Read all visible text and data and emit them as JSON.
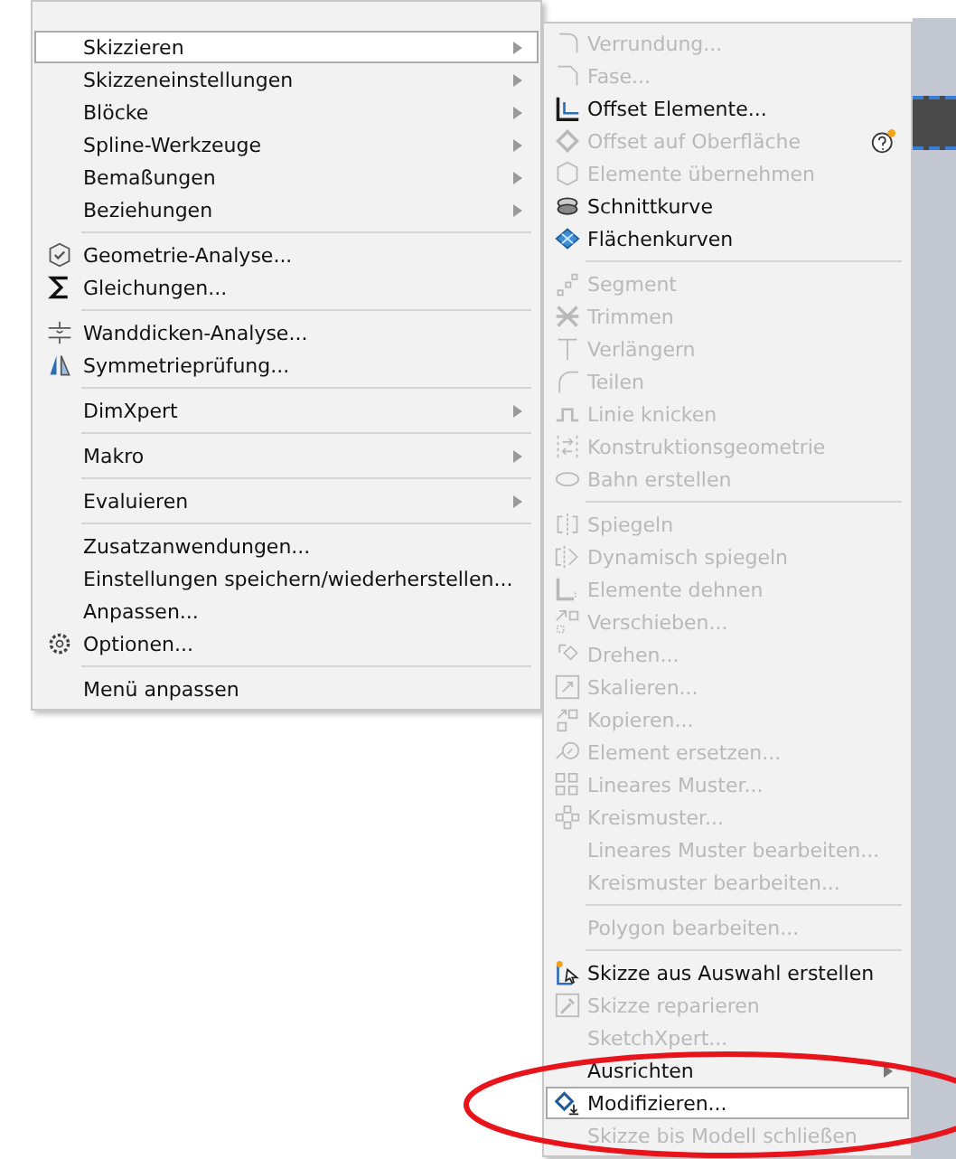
{
  "main_menu": {
    "items": [
      {
        "kind": "item",
        "label": "Skizzieren",
        "has_submenu": true,
        "selected": true
      },
      {
        "kind": "item",
        "label": "Skizzeneinstellungen",
        "has_submenu": true,
        "selected": false
      },
      {
        "kind": "item",
        "label": "Blöcke",
        "has_submenu": true,
        "selected": false
      },
      {
        "kind": "item",
        "label": "Spline-Werkzeuge",
        "has_submenu": true,
        "selected": false
      },
      {
        "kind": "item",
        "label": "Bemaßungen",
        "has_submenu": true,
        "selected": false
      },
      {
        "kind": "item",
        "label": "Beziehungen",
        "has_submenu": true,
        "selected": false
      },
      {
        "kind": "separator"
      },
      {
        "kind": "item",
        "label": "Geometrie-Analyse...",
        "has_submenu": false,
        "selected": false
      },
      {
        "kind": "item",
        "label": "Gleichungen...",
        "has_submenu": false,
        "selected": false
      },
      {
        "kind": "separator"
      },
      {
        "kind": "item",
        "label": "Wanddicken-Analyse...",
        "has_submenu": false,
        "selected": false
      },
      {
        "kind": "item",
        "label": "Symmetrieprüfung...",
        "has_submenu": false,
        "selected": false
      },
      {
        "kind": "separator"
      },
      {
        "kind": "item",
        "label": "DimXpert",
        "has_submenu": true,
        "selected": false
      },
      {
        "kind": "separator"
      },
      {
        "kind": "item",
        "label": "Makro",
        "has_submenu": true,
        "selected": false
      },
      {
        "kind": "separator"
      },
      {
        "kind": "item",
        "label": "Evaluieren",
        "has_submenu": true,
        "selected": false
      },
      {
        "kind": "separator"
      },
      {
        "kind": "item",
        "label": "Zusatzanwendungen...",
        "has_submenu": false,
        "selected": false
      },
      {
        "kind": "item",
        "label": "Einstellungen speichern/wiederherstellen...",
        "has_submenu": false,
        "selected": false
      },
      {
        "kind": "item",
        "label": "Anpassen...",
        "has_submenu": false,
        "selected": false
      },
      {
        "kind": "item",
        "label": "Optionen...",
        "has_submenu": false,
        "selected": false
      },
      {
        "kind": "separator"
      },
      {
        "kind": "item",
        "label": "Menü anpassen",
        "has_submenu": false,
        "selected": false
      }
    ]
  },
  "submenu": {
    "items": [
      {
        "kind": "item",
        "label": "Verrundung...",
        "disabled": true,
        "has_submenu": false,
        "selected": false
      },
      {
        "kind": "item",
        "label": "Fase...",
        "disabled": true,
        "has_submenu": false,
        "selected": false
      },
      {
        "kind": "item",
        "label": "Offset Elemente...",
        "disabled": false,
        "has_submenu": false,
        "selected": false
      },
      {
        "kind": "item",
        "label": "Offset auf Oberfläche",
        "disabled": true,
        "has_submenu": false,
        "selected": false
      },
      {
        "kind": "item",
        "label": "Elemente übernehmen",
        "disabled": true,
        "has_submenu": false,
        "selected": false
      },
      {
        "kind": "item",
        "label": "Schnittkurve",
        "disabled": false,
        "has_submenu": false,
        "selected": false
      },
      {
        "kind": "item",
        "label": "Flächenkurven",
        "disabled": false,
        "has_submenu": false,
        "selected": false
      },
      {
        "kind": "separator"
      },
      {
        "kind": "item",
        "label": "Segment",
        "disabled": true,
        "has_submenu": false,
        "selected": false
      },
      {
        "kind": "item",
        "label": "Trimmen",
        "disabled": true,
        "has_submenu": false,
        "selected": false
      },
      {
        "kind": "item",
        "label": "Verlängern",
        "disabled": true,
        "has_submenu": false,
        "selected": false
      },
      {
        "kind": "item",
        "label": "Teilen",
        "disabled": true,
        "has_submenu": false,
        "selected": false
      },
      {
        "kind": "item",
        "label": "Linie knicken",
        "disabled": true,
        "has_submenu": false,
        "selected": false
      },
      {
        "kind": "item",
        "label": "Konstruktionsgeometrie",
        "disabled": true,
        "has_submenu": false,
        "selected": false
      },
      {
        "kind": "item",
        "label": "Bahn erstellen",
        "disabled": true,
        "has_submenu": false,
        "selected": false
      },
      {
        "kind": "separator"
      },
      {
        "kind": "item",
        "label": "Spiegeln",
        "disabled": true,
        "has_submenu": false,
        "selected": false
      },
      {
        "kind": "item",
        "label": "Dynamisch spiegeln",
        "disabled": true,
        "has_submenu": false,
        "selected": false
      },
      {
        "kind": "item",
        "label": "Elemente dehnen",
        "disabled": true,
        "has_submenu": false,
        "selected": false
      },
      {
        "kind": "item",
        "label": "Verschieben...",
        "disabled": true,
        "has_submenu": false,
        "selected": false
      },
      {
        "kind": "item",
        "label": "Drehen...",
        "disabled": true,
        "has_submenu": false,
        "selected": false
      },
      {
        "kind": "item",
        "label": "Skalieren...",
        "disabled": true,
        "has_submenu": false,
        "selected": false
      },
      {
        "kind": "item",
        "label": "Kopieren...",
        "disabled": true,
        "has_submenu": false,
        "selected": false
      },
      {
        "kind": "item",
        "label": "Element ersetzen...",
        "disabled": true,
        "has_submenu": false,
        "selected": false
      },
      {
        "kind": "item",
        "label": "Lineares Muster...",
        "disabled": true,
        "has_submenu": false,
        "selected": false
      },
      {
        "kind": "item",
        "label": "Kreismuster...",
        "disabled": true,
        "has_submenu": false,
        "selected": false
      },
      {
        "kind": "item",
        "label": "Lineares Muster bearbeiten...",
        "disabled": true,
        "has_submenu": false,
        "selected": false
      },
      {
        "kind": "item",
        "label": "Kreismuster bearbeiten...",
        "disabled": true,
        "has_submenu": false,
        "selected": false
      },
      {
        "kind": "separator"
      },
      {
        "kind": "item",
        "label": "Polygon bearbeiten...",
        "disabled": true,
        "has_submenu": false,
        "selected": false
      },
      {
        "kind": "separator"
      },
      {
        "kind": "item",
        "label": "Skizze aus Auswahl erstellen",
        "disabled": false,
        "has_submenu": false,
        "selected": false
      },
      {
        "kind": "item",
        "label": "Skizze reparieren",
        "disabled": true,
        "has_submenu": false,
        "selected": false
      },
      {
        "kind": "item",
        "label": "SketchXpert...",
        "disabled": true,
        "has_submenu": false,
        "selected": false
      },
      {
        "kind": "item",
        "label": "Ausrichten",
        "disabled": false,
        "has_submenu": true,
        "selected": false
      },
      {
        "kind": "item",
        "label": "Modifizieren...",
        "disabled": false,
        "has_submenu": false,
        "selected": true
      },
      {
        "kind": "item",
        "label": "Skizze bis Modell schließen",
        "disabled": true,
        "has_submenu": false,
        "selected": false
      }
    ]
  }
}
